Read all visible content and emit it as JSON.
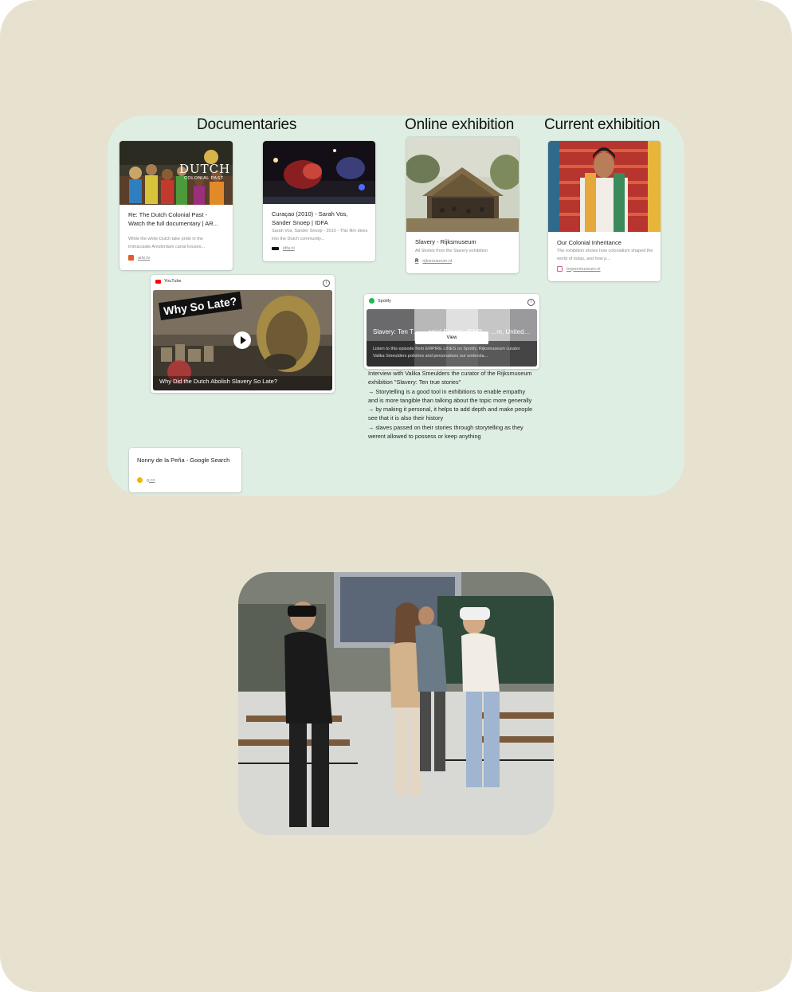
{
  "headings": {
    "documentaries": "Documentaries",
    "online_exhibition": "Online exhibition",
    "current_exhibition": "Current exhibition"
  },
  "cards": {
    "dutch_past": {
      "thumb_title": "DUTCH",
      "thumb_subtitle": "COLONIAL PAST",
      "title": "Re: The Dutch Colonial Past - Watch the full documentary | AR...",
      "desc": "While the white Dutch take pride in the immaculate Amsterdam canal houses...",
      "source": "arte.tv"
    },
    "curacao": {
      "title": "Curaçao (2010) - Sarah Vos, Sander Snoep | IDFA",
      "desc": "Sarah Vos, Sander Snoep - 2010 - This film dives into the Dutch community...",
      "source": "idfa.nl"
    },
    "rijksmuseum": {
      "title": "Slavery - Rijksmuseum",
      "desc": "All Stories from the Slavery exhibition",
      "source": "rijksmuseum.nl"
    },
    "tropen": {
      "title": "Our Colonial Inheritance",
      "desc": "The exhibition shows how colonialism shaped the world of today, and how p...",
      "source": "tropenmuseum.nl"
    },
    "youtube": {
      "platform": "YouTube",
      "banner": "Why So Late?",
      "caption": "Why Did the Dutch Abolish Slavery So Late?"
    },
    "spotify": {
      "platform": "Spotify",
      "title": "Slavery: Ten T… …onial Slavery (EMP… …m, United…",
      "desc": "Listen to this episode from EMPIRE LINES on Spotify. Rijksmuseum curator Valika Smeulders polishes and personalises our understa...",
      "view_label": "View"
    },
    "google": {
      "title": "Nonny de la Peña - Google Search",
      "source": "g.co"
    }
  },
  "note": {
    "lines": [
      "Interview with Valika Smeulders the curator of the Rijksmuseum exhibition \"Slavery: Ten true stories\"",
      "→ Storytelling is a good tool in exhibitions to enable empathy and is more tangible than talking about the topic more generally",
      "→ by making it personal, it helps to add depth and make people see that it is also their history",
      "→ slaves passed on their stories through storytelling as they werent allowed to possess or keep anything"
    ]
  },
  "colors": {
    "page_bg": "#e7e1d0",
    "board_bg": "#dfeee3",
    "youtube_red": "#ff0000",
    "spotify_green": "#1db954"
  }
}
